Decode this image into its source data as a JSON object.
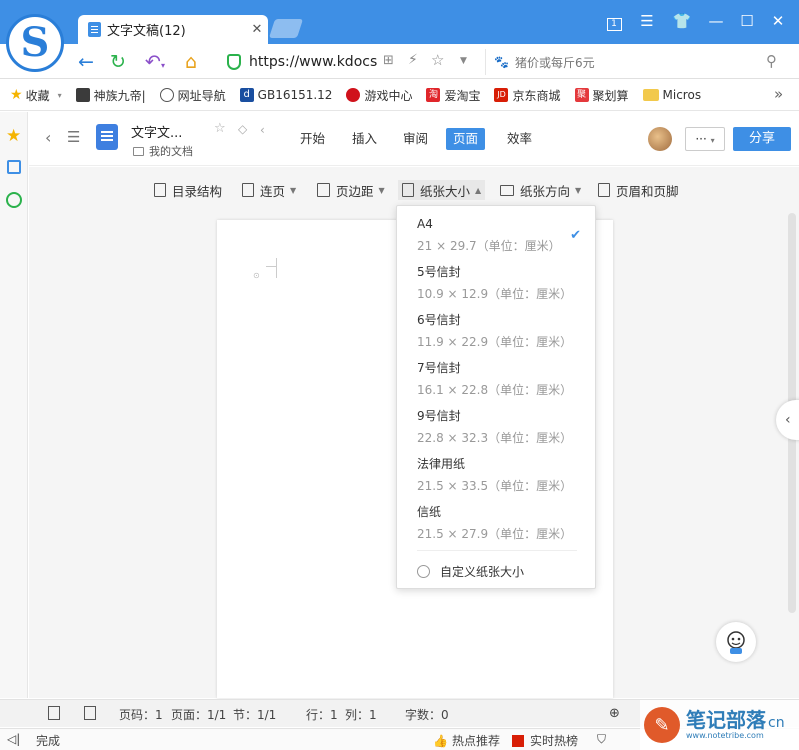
{
  "browser": {
    "tab_title": "文字文稿(12)",
    "url": "https://www.kdocs",
    "search_placeholder": "猪价或每斤6元"
  },
  "bookmarks": [
    {
      "label": "收藏",
      "icon": "star-icon",
      "color": "#f5b400"
    },
    {
      "label": "神族九帝|",
      "icon": "game-icon",
      "color": "#3b3b3b"
    },
    {
      "label": "网址导航",
      "icon": "globe-icon",
      "color": "#555555"
    },
    {
      "label": "GB16151.12",
      "icon": "d-icon",
      "color": "#1a4fa0"
    },
    {
      "label": "游戏中心",
      "icon": "game-center-icon",
      "color": "#d0121b"
    },
    {
      "label": "爱淘宝",
      "icon": "taobao-icon",
      "color": "#e0262b"
    },
    {
      "label": "京东商城",
      "icon": "jd-icon",
      "color": "#d81e06"
    },
    {
      "label": "聚划算",
      "icon": "juhuasuan-icon",
      "color": "#e4393c"
    },
    {
      "label": "Micros",
      "icon": "folder-icon",
      "color": "#f2c94c"
    }
  ],
  "document": {
    "title": "文字文...",
    "location": "我的文档"
  },
  "menu_tabs": [
    "开始",
    "插入",
    "审阅",
    "页面",
    "效率"
  ],
  "active_tab": "页面",
  "header": {
    "more_label": "···",
    "share_label": "分享"
  },
  "toolbar": {
    "toc": "目录结构",
    "continuous": "连页",
    "margins": "页边距",
    "paper_size": "纸张大小",
    "orientation": "纸张方向",
    "header_footer": "页眉和页脚"
  },
  "paper_sizes": [
    {
      "name": "A4",
      "dims": "21 × 29.7（单位：厘米）",
      "selected": true
    },
    {
      "name": "5号信封",
      "dims": "10.9 × 12.9（单位：厘米）",
      "selected": false
    },
    {
      "name": "6号信封",
      "dims": "11.9 × 22.9（单位：厘米）",
      "selected": false
    },
    {
      "name": "7号信封",
      "dims": "16.1 × 22.8（单位：厘米）",
      "selected": false
    },
    {
      "name": "9号信封",
      "dims": "22.8 × 32.3（单位：厘米）",
      "selected": false
    },
    {
      "name": "法律用纸",
      "dims": "21.5 × 33.5（单位：厘米）",
      "selected": false
    },
    {
      "name": "信纸",
      "dims": "21.5 × 27.9（单位：厘米）",
      "selected": false
    }
  ],
  "custom_size_label": "自定义纸张大小",
  "status": {
    "page_code": "页码：1",
    "page": "页面：1/1",
    "section": "节：1/1",
    "line": "行：1",
    "column": "列：1",
    "word_count": "字数：0"
  },
  "bottom": {
    "done": "完成",
    "hot_recommend": "热点推荐",
    "realtime_hot": "实时热榜"
  },
  "watermark": {
    "text": "笔记部落",
    "sub": "www.notetribe.com",
    "domain": "cn"
  },
  "colors": {
    "accent": "#3e8fe5",
    "titlebar": "#3e8fe5"
  }
}
